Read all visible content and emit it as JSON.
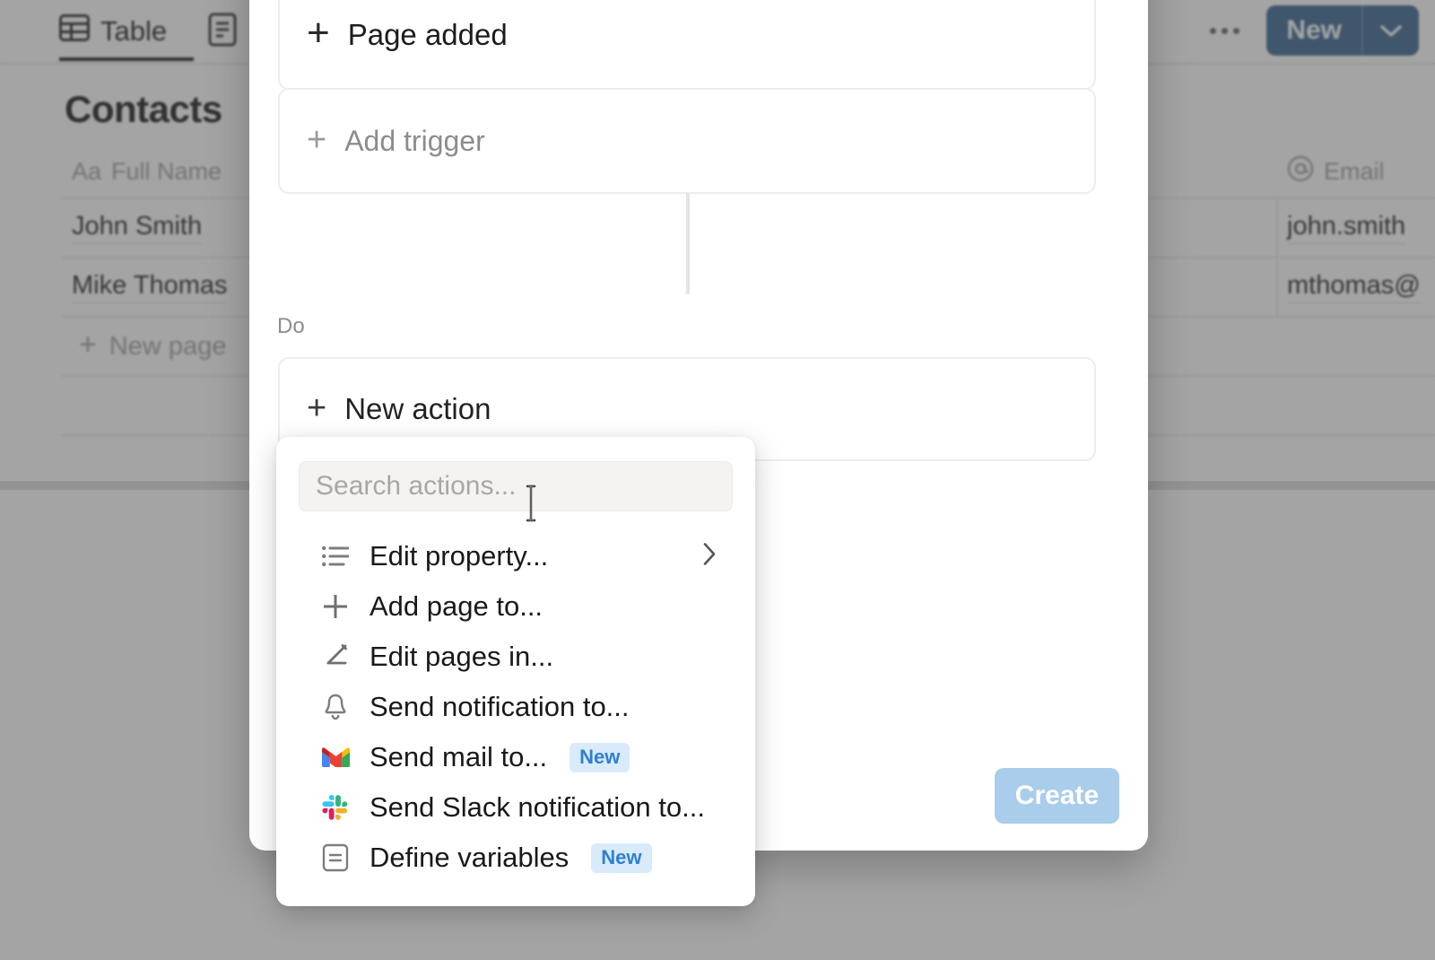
{
  "background": {
    "tabs": [
      {
        "label": "Table",
        "icon": "table-icon",
        "active": true
      },
      {
        "label": "",
        "icon": "document-icon",
        "active": false
      }
    ],
    "page_title": "Contacts",
    "table": {
      "columns": [
        {
          "label": "Full Name",
          "type_icon": "Aa"
        },
        {
          "label": "Email",
          "type_icon": "@"
        }
      ],
      "rows": [
        {
          "full_name": "John Smith",
          "email": "john.smith"
        },
        {
          "full_name": "Mike Thomas",
          "email": "mthomas@"
        }
      ],
      "new_row_label": "New page"
    },
    "header_actions": {
      "more_label": "•••",
      "new_label": "New",
      "new_color": "#2f5d8c"
    }
  },
  "modal": {
    "trigger_card_label": "Page added",
    "add_trigger_label": "Add trigger",
    "do_section_label": "Do",
    "new_action_label": "New action",
    "create_button_label": "Create",
    "create_button_color": "#a9cdeb"
  },
  "dropdown": {
    "search": {
      "placeholder": "Search actions...",
      "value": ""
    },
    "items": [
      {
        "label": "Edit property...",
        "icon": "list-icon",
        "badge": "",
        "has_submenu": true
      },
      {
        "label": "Add page to...",
        "icon": "plus-icon",
        "badge": "",
        "has_submenu": false
      },
      {
        "label": "Edit pages in...",
        "icon": "pencil-icon",
        "badge": "",
        "has_submenu": false
      },
      {
        "label": "Send notification to...",
        "icon": "bell-icon",
        "badge": "",
        "has_submenu": false
      },
      {
        "label": "Send mail to...",
        "icon": "gmail-icon",
        "badge": "New",
        "has_submenu": false
      },
      {
        "label": "Send Slack notification to...",
        "icon": "slack-icon",
        "badge": "",
        "has_submenu": false
      },
      {
        "label": "Define variables",
        "icon": "variables-icon",
        "badge": "New",
        "has_submenu": false
      }
    ],
    "badge_bg": "#d9ebfa",
    "badge_fg": "#2f7fd1"
  }
}
